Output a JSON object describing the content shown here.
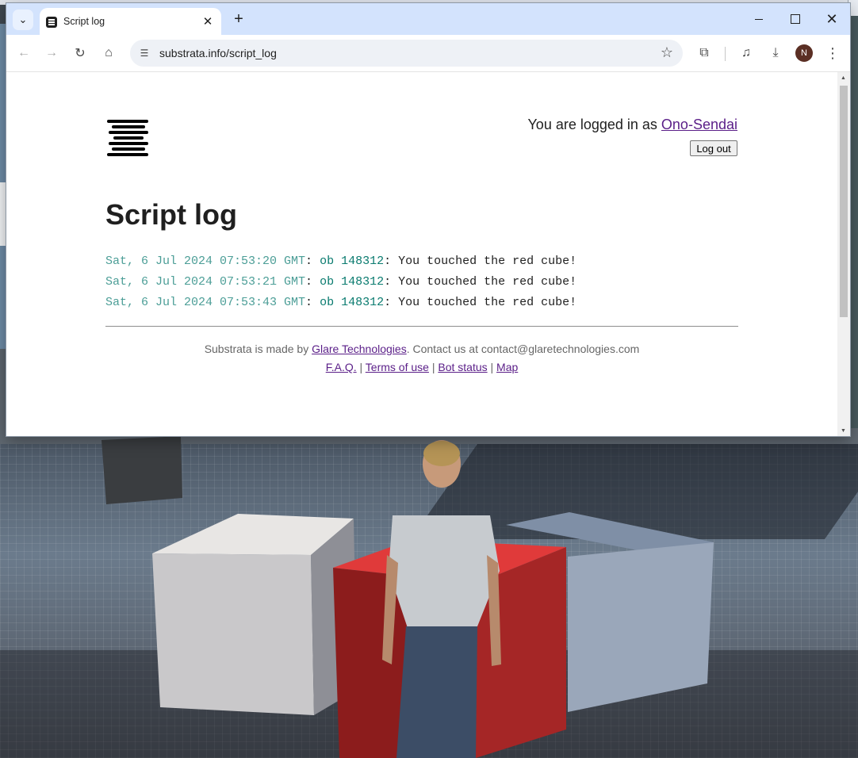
{
  "browser": {
    "tab_title": "Script log",
    "url": "substrata.info/script_log",
    "avatar_initial": "N"
  },
  "page": {
    "login_prefix": "You are logged in as ",
    "username": "Ono-Sendai",
    "logout_label": "Log out",
    "title": "Script log",
    "log_entries": [
      {
        "time": "Sat, 6 Jul 2024 07:53:20 GMT",
        "object": "ob 148312",
        "message": "You touched the red cube!"
      },
      {
        "time": "Sat, 6 Jul 2024 07:53:21 GMT",
        "object": "ob 148312",
        "message": "You touched the red cube!"
      },
      {
        "time": "Sat, 6 Jul 2024 07:53:43 GMT",
        "object": "ob 148312",
        "message": "You touched the red cube!"
      }
    ],
    "footer": {
      "made_by_prefix": "Substrata is made by ",
      "company": "Glare Technologies",
      "contact": ". Contact us at contact@glaretechnologies.com",
      "links": [
        "F.A.Q.",
        "Terms of use",
        "Bot status",
        "Map"
      ],
      "separator": " | "
    }
  },
  "icons": {
    "tab_menu": "chevron-down-icon",
    "close": "close-icon",
    "new_tab": "plus-icon",
    "back": "arrow-left-icon",
    "forward": "arrow-right-icon",
    "reload": "reload-icon",
    "home": "home-icon",
    "site_info": "tune-icon",
    "bookmark": "star-icon",
    "extensions": "puzzle-icon",
    "media": "media-control-icon",
    "downloads": "download-icon",
    "menu": "kebab-menu-icon"
  }
}
